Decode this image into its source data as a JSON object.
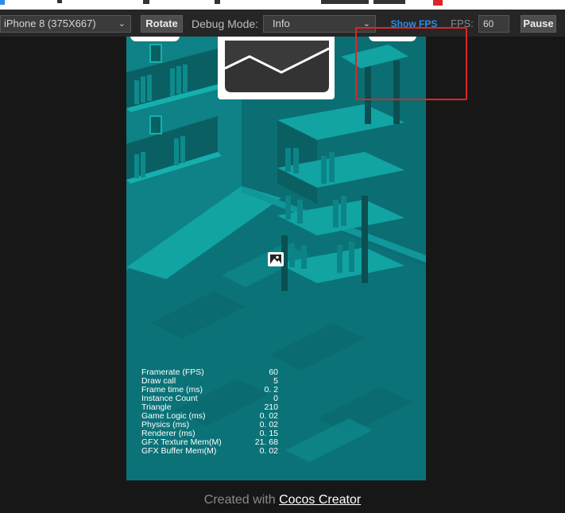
{
  "toolbar": {
    "device": "iPhone 8 (375X667)",
    "rotate_label": "Rotate",
    "debug_mode_label": "Debug Mode:",
    "debug_mode_value": "Info",
    "show_fps_label": "Show FPS",
    "fps_label": "FPS:",
    "fps_value": "60",
    "pause_label": "Pause"
  },
  "stats": [
    {
      "label": "Framerate (FPS)",
      "value": "60"
    },
    {
      "label": "Draw call",
      "value": "5"
    },
    {
      "label": "Frame time (ms)",
      "value": "0. 2"
    },
    {
      "label": "Instance Count",
      "value": "0"
    },
    {
      "label": "Triangle",
      "value": "210"
    },
    {
      "label": "Game Logic (ms)",
      "value": "0. 02"
    },
    {
      "label": "Physics (ms)",
      "value": "0. 02"
    },
    {
      "label": "Renderer (ms)",
      "value": "0. 15"
    },
    {
      "label": "GFX Texture Mem(M)",
      "value": "21. 68"
    },
    {
      "label": "GFX Buffer Mem(M)",
      "value": "0. 02"
    }
  ],
  "footer": {
    "created_with": "Created with",
    "link_text": "Cocos Creator"
  },
  "colors": {
    "toolbar_bg": "#262626",
    "page_bg": "#171717",
    "accent_blue": "#2d8ceb",
    "highlight_red": "#e02424",
    "game_teal": "#0d7a7f"
  }
}
